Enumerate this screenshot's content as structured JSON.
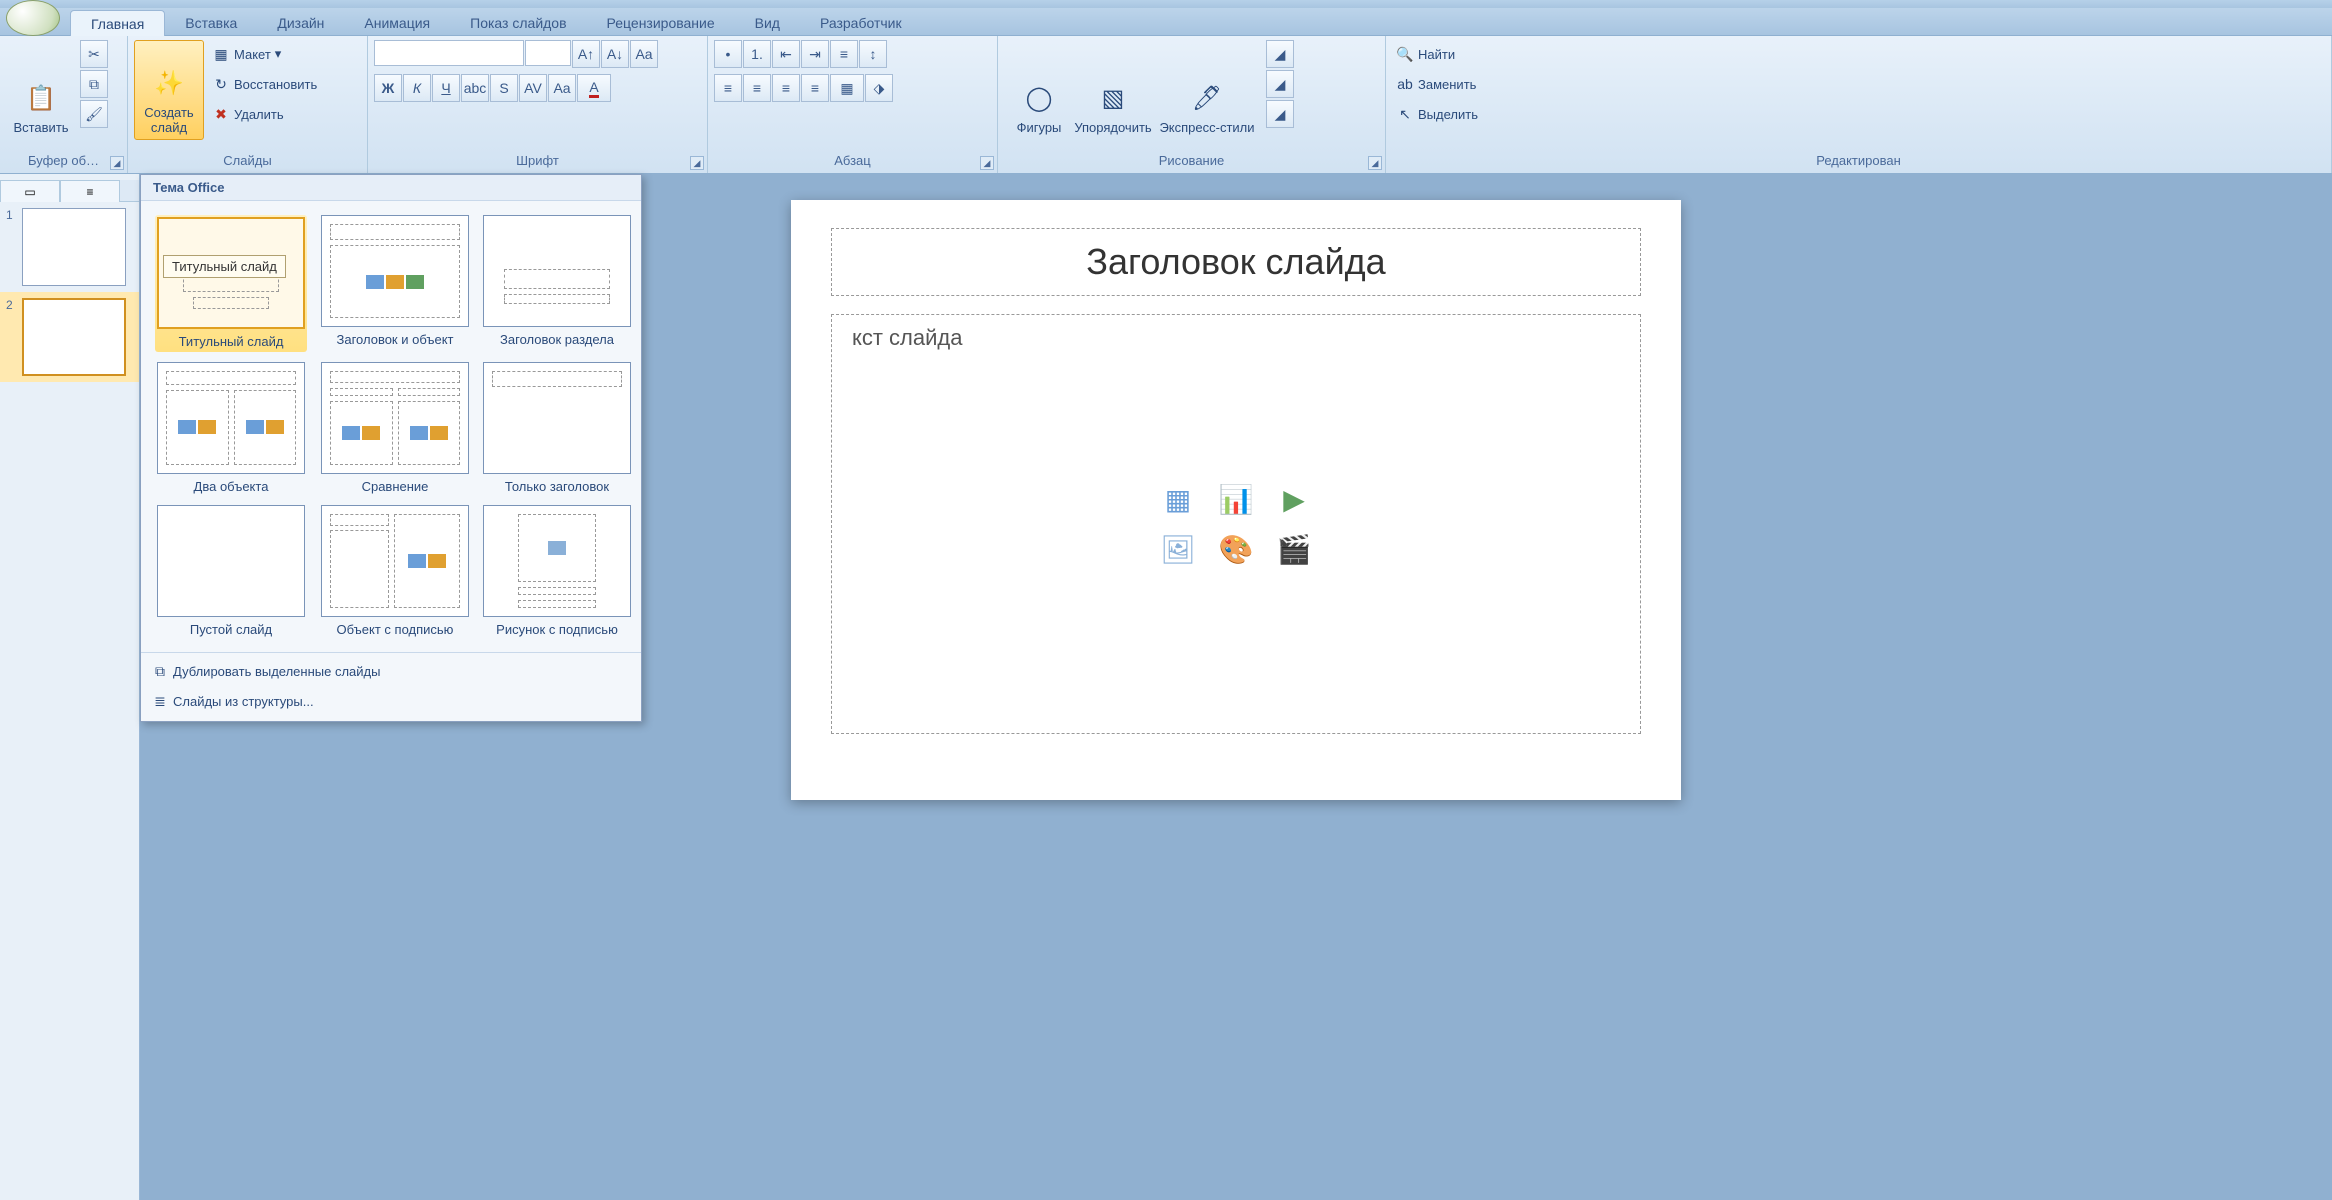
{
  "tabs": {
    "home": "Главная",
    "insert": "Вставка",
    "design": "Дизайн",
    "animation": "Анимация",
    "slideshow": "Показ слайдов",
    "review": "Рецензирование",
    "view": "Вид",
    "developer": "Разработчик"
  },
  "groups": {
    "clipboard": {
      "label": "Буфер об…",
      "paste": "Вставить"
    },
    "slides": {
      "label": "Слайды",
      "new_slide": "Создать\nслайд",
      "layout": "Макет",
      "reset": "Восстановить",
      "delete": "Удалить"
    },
    "font": {
      "label": "Шрифт"
    },
    "paragraph": {
      "label": "Абзац"
    },
    "drawing": {
      "label": "Рисование",
      "shapes": "Фигуры",
      "arrange": "Упорядочить",
      "quick_styles": "Экспресс-стили"
    },
    "editing": {
      "label": "Редактирован",
      "find": "Найти",
      "replace": "Заменить",
      "select": "Выделить"
    }
  },
  "layout_popup": {
    "theme_header": "Тема Office",
    "tooltip": "Титульный слайд",
    "layouts": [
      "Титульный слайд",
      "Заголовок и объект",
      "Заголовок раздела",
      "Два объекта",
      "Сравнение",
      "Только заголовок",
      "Пустой слайд",
      "Объект с подписью",
      "Рисунок с подписью"
    ],
    "footer": {
      "duplicate": "Дублировать выделенные слайды",
      "from_outline": "Слайды из структуры..."
    }
  },
  "slide": {
    "title_placeholder": "Заголовок слайда",
    "body_placeholder_partial": "кст слайда"
  },
  "thumbs": {
    "n1": "1",
    "n2": "2"
  }
}
